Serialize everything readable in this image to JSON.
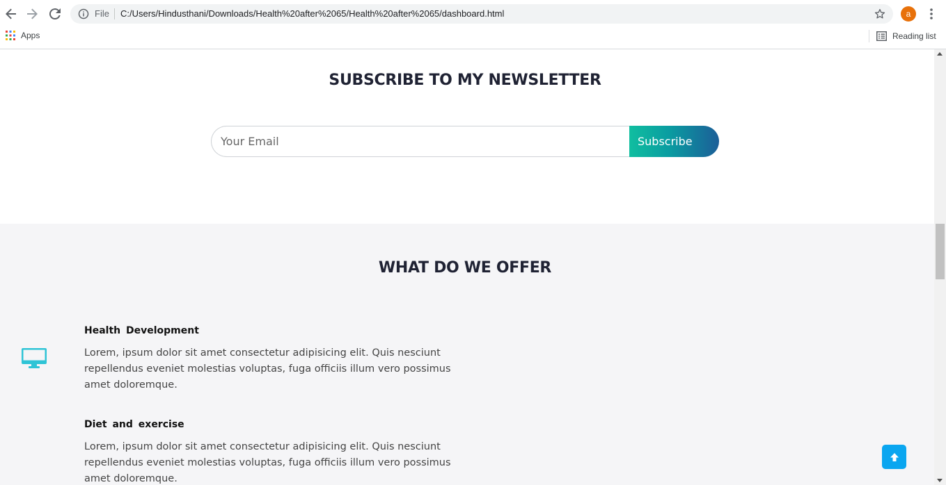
{
  "browser": {
    "file_label": "File",
    "url": "C:/Users/Hindusthani/Downloads/Health%20after%2065/Health%20after%2065/dashboard.html",
    "avatar_letter": "a",
    "apps_label": "Apps",
    "reading_list_label": "Reading list",
    "avatar_color": "#e8710a"
  },
  "newsletter": {
    "title": "SUBSCRIBE TO MY NEWSLETTER",
    "email_placeholder": "Your Email",
    "subscribe_label": "Subscribe",
    "button_gradient": [
      "#10bea0",
      "#1c5e98"
    ]
  },
  "offer": {
    "title": "WHAT DO WE OFFER",
    "icon": "desktop-icon",
    "icon_color": "#2ec4d6",
    "services": [
      {
        "heading": "Health  Development",
        "text": "Lorem, ipsum dolor sit amet consectetur adipisicing elit. Quis nesciunt repellendus eveniet molestias voluptas, fuga officiis illum vero possimus amet doloremque."
      },
      {
        "heading": "Diet  and  exercise",
        "text": "Lorem, ipsum dolor sit amet consectetur adipisicing elit. Quis nesciunt repellendus eveniet molestias voluptas, fuga officiis illum vero possimus amet doloremque."
      }
    ]
  },
  "back_to_top": {
    "icon": "arrow-up-icon",
    "color": "#0aa6f0"
  }
}
